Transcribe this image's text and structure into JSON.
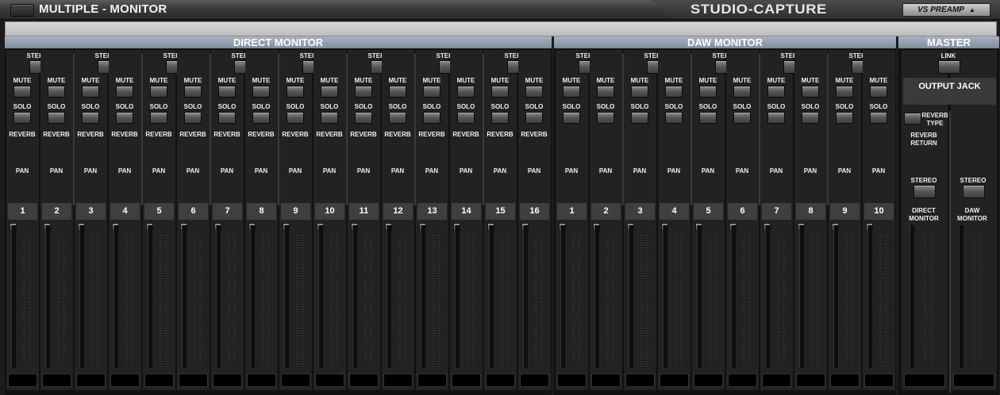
{
  "window": {
    "title": "MULTIPLE - MONITOR",
    "brand": "STUDIO-CAPTURE",
    "preamp_button": "VS PREAMP",
    "preamp_arrow": "▲"
  },
  "sections": {
    "direct": "DIRECT MONITOR",
    "daw": "DAW MONITOR",
    "master": "MASTER"
  },
  "labels": {
    "stereo": "STEREO",
    "mute": "MUTE",
    "solo": "SOLO",
    "reverb": "REVERB",
    "pan": "PAN"
  },
  "direct_channels": [
    "1",
    "2",
    "3",
    "4",
    "5",
    "6",
    "7",
    "8",
    "9",
    "10",
    "11",
    "12",
    "13",
    "14",
    "15",
    "16"
  ],
  "daw_channels": [
    "1",
    "2",
    "3",
    "4",
    "5",
    "6",
    "7",
    "8",
    "9",
    "10"
  ],
  "master": {
    "link": "LINK",
    "output_jack": "OUTPUT JACK",
    "reverb_type_1": "REVERB",
    "reverb_type_2": "TYPE",
    "reverb_return_1": "REVERB",
    "reverb_return_2": "RETURN",
    "stereo": "STEREO",
    "direct_monitor_1": "DIRECT",
    "direct_monitor_2": "MONITOR",
    "daw_monitor_1": "DAW",
    "daw_monitor_2": "MONITOR"
  }
}
